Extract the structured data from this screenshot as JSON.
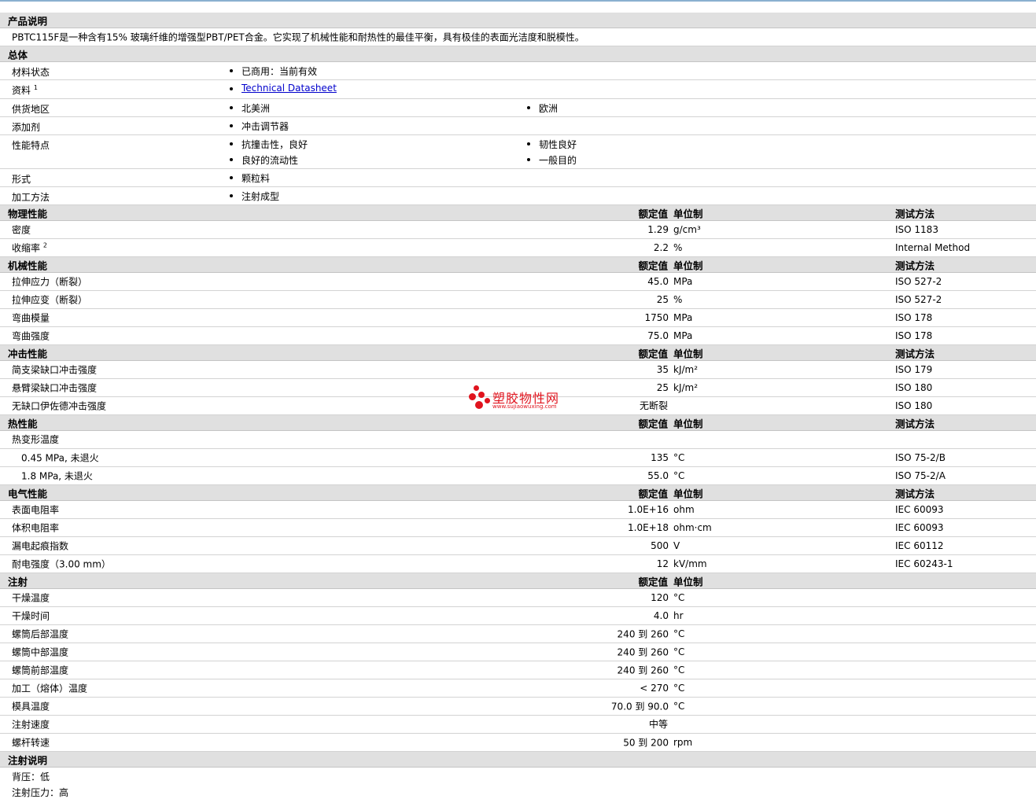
{
  "product_description": {
    "title": "产品说明",
    "text": "PBTC115F是一种含有15% 玻璃纤维的增强型PBT/PET合金。它实现了机械性能和耐热性的最佳平衡，具有极佳的表面光洁度和脱模性。"
  },
  "general": {
    "title": "总体",
    "rows": [
      {
        "label": "材料状态",
        "items": [
          "已商用：当前有效"
        ]
      },
      {
        "label": "资料",
        "sup": "1",
        "items": [
          "Technical Datasheet"
        ],
        "link": true
      },
      {
        "label": "供货地区",
        "items": [
          "北美洲",
          "欧洲"
        ]
      },
      {
        "label": "添加剂",
        "items": [
          "冲击调节器"
        ]
      },
      {
        "label": "性能特点",
        "items": [
          "抗撞击性，良好",
          "韧性良好",
          "良好的流动性",
          "一般目的"
        ]
      },
      {
        "label": "形式",
        "items": [
          "颗粒料"
        ]
      },
      {
        "label": "加工方法",
        "items": [
          "注射成型"
        ]
      }
    ]
  },
  "headers": {
    "nominal": "额定值",
    "unit": "单位制",
    "test_method": "测试方法"
  },
  "sections": [
    {
      "title": "物理性能",
      "has_method": true,
      "rows": [
        {
          "label": "密度",
          "value": "1.29",
          "unit": "g/cm³",
          "method": "ISO 1183"
        },
        {
          "label": "收缩率",
          "sup": "2",
          "value": "2.2",
          "unit": "%",
          "method": "Internal Method"
        }
      ]
    },
    {
      "title": "机械性能",
      "has_method": true,
      "rows": [
        {
          "label": "拉伸应力（断裂）",
          "value": "45.0",
          "unit": "MPa",
          "method": "ISO 527-2"
        },
        {
          "label": "拉伸应变（断裂）",
          "value": "25",
          "unit": "%",
          "method": "ISO 527-2"
        },
        {
          "label": "弯曲模量",
          "value": "1750",
          "unit": "MPa",
          "method": "ISO 178"
        },
        {
          "label": "弯曲强度",
          "value": "75.0",
          "unit": "MPa",
          "method": "ISO 178"
        }
      ]
    },
    {
      "title": "冲击性能",
      "has_method": true,
      "rows": [
        {
          "label": "简支梁缺口冲击强度",
          "value": "35",
          "unit": "kJ/m²",
          "method": "ISO 179"
        },
        {
          "label": "悬臂梁缺口冲击强度",
          "value": "25",
          "unit": "kJ/m²",
          "method": "ISO 180"
        },
        {
          "label": "无缺口伊佐德冲击强度",
          "value": "无断裂",
          "unit": "",
          "method": "ISO 180"
        }
      ]
    },
    {
      "title": "热性能",
      "has_method": true,
      "rows": [
        {
          "label": "热变形温度",
          "value": "",
          "unit": "",
          "method": ""
        },
        {
          "label": "0.45 MPa, 未退火",
          "indent": true,
          "value": "135",
          "unit": "°C",
          "method": "ISO 75-2/B"
        },
        {
          "label": "1.8 MPa, 未退火",
          "indent": true,
          "value": "55.0",
          "unit": "°C",
          "method": "ISO 75-2/A"
        }
      ]
    },
    {
      "title": "电气性能",
      "has_method": true,
      "rows": [
        {
          "label": "表面电阻率",
          "value": "1.0E+16",
          "unit": "ohm",
          "method": "IEC 60093"
        },
        {
          "label": "体积电阻率",
          "value": "1.0E+18",
          "unit": "ohm·cm",
          "method": "IEC 60093"
        },
        {
          "label": "漏电起痕指数",
          "value": "500",
          "unit": "V",
          "method": "IEC 60112"
        },
        {
          "label": "耐电强度（3.00 mm）",
          "value": "12",
          "unit": "kV/mm",
          "method": "IEC 60243-1"
        }
      ]
    },
    {
      "title": "注射",
      "has_method": false,
      "rows": [
        {
          "label": "干燥温度",
          "value": "120",
          "unit": "°C",
          "method": ""
        },
        {
          "label": "干燥时间",
          "value": "4.0",
          "unit": "hr",
          "method": ""
        },
        {
          "label": "螺筒后部温度",
          "value": "240 到  260",
          "unit": "°C",
          "method": ""
        },
        {
          "label": "螺筒中部温度",
          "value": "240 到  260",
          "unit": "°C",
          "method": ""
        },
        {
          "label": "螺筒前部温度",
          "value": "240 到  260",
          "unit": "°C",
          "method": ""
        },
        {
          "label": "加工（熔体）温度",
          "value": "< 270",
          "unit": "°C",
          "method": ""
        },
        {
          "label": "模具温度",
          "value": "70.0 到  90.0",
          "unit": "°C",
          "method": ""
        },
        {
          "label": "注射速度",
          "value": "中等",
          "unit": "",
          "method": ""
        },
        {
          "label": "螺杆转速",
          "value": "50 到  200",
          "unit": "rpm",
          "method": ""
        }
      ]
    }
  ],
  "injection_notes": {
    "title": "注射说明",
    "lines": [
      "背压：低",
      "注射压力：高"
    ]
  },
  "watermark": {
    "cn": "塑胶物性网",
    "en": "www.sujiaowuxing.com",
    "color": "#e0141e"
  }
}
